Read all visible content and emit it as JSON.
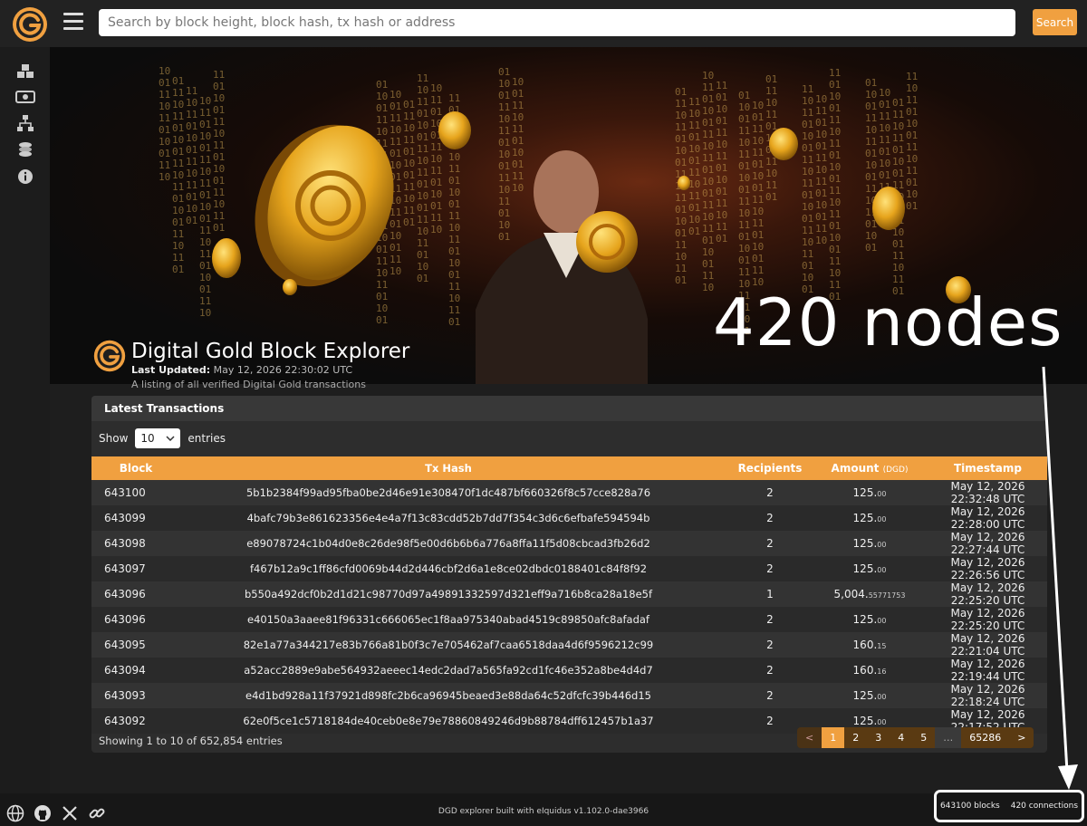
{
  "search": {
    "placeholder": "Search by block height, block hash, tx hash or address",
    "button_label": "Search"
  },
  "header": {
    "title": "Digital Gold Block Explorer",
    "last_updated_label": "Last Updated:",
    "last_updated_value": "May 12, 2026 22:30:02 UTC",
    "subtitle": "A listing of all verified Digital Gold transactions"
  },
  "annotation": {
    "text": "420 nodes"
  },
  "card": {
    "title": "Latest Transactions",
    "show_label": "Show",
    "entries_value": "10",
    "entries_label": "entries",
    "columns": {
      "block": "Block",
      "hash": "Tx Hash",
      "recipients": "Recipients",
      "amount": "Amount",
      "amount_unit": "(DGD)",
      "timestamp": "Timestamp"
    },
    "rows": [
      {
        "block": "643100",
        "hash": "5b1b2384f99ad95fba0be2d46e91e308470f1dc487bf660326f8c57cce828a76",
        "recipients": "2",
        "amount_int": "125.",
        "amount_dec": "00",
        "timestamp": "May 12, 2026 22:32:48 UTC"
      },
      {
        "block": "643099",
        "hash": "4bafc79b3e861623356e4e4a7f13c83cdd52b7dd7f354c3d6c6efbafe594594b",
        "recipients": "2",
        "amount_int": "125.",
        "amount_dec": "00",
        "timestamp": "May 12, 2026 22:28:00 UTC"
      },
      {
        "block": "643098",
        "hash": "e89078724c1b04d0e8c26de98f5e00d6b6b6a776a8ffa11f5d08cbcad3fb26d2",
        "recipients": "2",
        "amount_int": "125.",
        "amount_dec": "00",
        "timestamp": "May 12, 2026 22:27:44 UTC"
      },
      {
        "block": "643097",
        "hash": "f467b12a9c1ff86cfd0069b44d2d446cbf2d6a1e8ce02dbdc0188401c84f8f92",
        "recipients": "2",
        "amount_int": "125.",
        "amount_dec": "00",
        "timestamp": "May 12, 2026 22:26:56 UTC"
      },
      {
        "block": "643096",
        "hash": "b550a492dcf0b2d1d21c98770d97a49891332597d321eff9a716b8ca28a18e5f",
        "recipients": "1",
        "amount_int": "5,004.",
        "amount_dec": "55771753",
        "timestamp": "May 12, 2026 22:25:20 UTC"
      },
      {
        "block": "643096",
        "hash": "e40150a3aaee81f96331c666065ec1f8aa975340abad4519c89850afc8afadaf",
        "recipients": "2",
        "amount_int": "125.",
        "amount_dec": "00",
        "timestamp": "May 12, 2026 22:25:20 UTC"
      },
      {
        "block": "643095",
        "hash": "82e1a77a344217e83b766a81b0f3c7e705462af7caa6518daa4d6f9596212c99",
        "recipients": "2",
        "amount_int": "160.",
        "amount_dec": "15",
        "timestamp": "May 12, 2026 22:21:04 UTC"
      },
      {
        "block": "643094",
        "hash": "a52acc2889e9abe564932aeeec14edc2dad7a565fa92cd1fc46e352a8be4d4d7",
        "recipients": "2",
        "amount_int": "160.",
        "amount_dec": "16",
        "timestamp": "May 12, 2026 22:19:44 UTC"
      },
      {
        "block": "643093",
        "hash": "e4d1bd928a11f37921d898fc2b6ca96945beaed3e88da64c52dfcfc39b446d15",
        "recipients": "2",
        "amount_int": "125.",
        "amount_dec": "00",
        "timestamp": "May 12, 2026 22:18:24 UTC"
      },
      {
        "block": "643092",
        "hash": "62e0f5ce1c5718184de40ceb0e8e79e78860849246d9b88784dff612457b1a37",
        "recipients": "2",
        "amount_int": "125.",
        "amount_dec": "00",
        "timestamp": "May 12, 2026 22:17:52 UTC"
      }
    ],
    "showing_text": "Showing 1 to 10 of 652,854 entries",
    "pagination": {
      "prev": "<",
      "pages": [
        "1",
        "2",
        "3",
        "4",
        "5"
      ],
      "ellipsis": "…",
      "last": "65286",
      "next": ">"
    }
  },
  "footer": {
    "credit": "DGD explorer built with eIquidus v1.102.0-dae3966",
    "blocks": "643100 blocks",
    "connections": "420 connections"
  },
  "colors": {
    "accent": "#f0a040",
    "background": "#1e1e1e"
  }
}
